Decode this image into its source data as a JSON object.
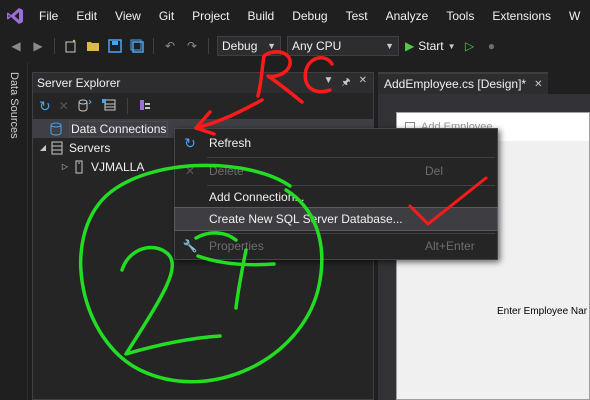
{
  "menu": [
    "File",
    "Edit",
    "View",
    "Git",
    "Project",
    "Build",
    "Debug",
    "Test",
    "Analyze",
    "Tools",
    "Extensions",
    "W"
  ],
  "toolbar": {
    "config_label": "Debug",
    "platform_label": "Any CPU",
    "start_label": "Start"
  },
  "side_tab_label": "Data Sources",
  "server_explorer": {
    "title": "Server Explorer",
    "tree": [
      {
        "label": "Data Connections",
        "level": 0
      },
      {
        "label": "Servers",
        "level": 0
      },
      {
        "label": "VJMALLA",
        "level": 1
      }
    ]
  },
  "document": {
    "tab_label": "AddEmployee.cs [Design]*",
    "form_title": "Add Employee",
    "form_label": "Enter Employee Nar"
  },
  "context_menu": {
    "items": [
      {
        "label": "Refresh",
        "shortcut": "",
        "enabled": true
      },
      {
        "label": "Delete",
        "shortcut": "Del",
        "enabled": false
      },
      {
        "label": "Add Connection...",
        "shortcut": "",
        "enabled": true
      },
      {
        "label": "Create New SQL Server Database...",
        "shortcut": "",
        "enabled": true
      },
      {
        "label": "Properties",
        "shortcut": "Alt+Enter",
        "enabled": false
      }
    ]
  },
  "annotations": {
    "rc_text": "RC",
    "circle_text": "2"
  },
  "colors": {
    "accent_purple": "#9b6fd6",
    "run_green": "#4ec94e",
    "annotation_red": "#ff1a1a",
    "annotation_green": "#22dd22"
  }
}
